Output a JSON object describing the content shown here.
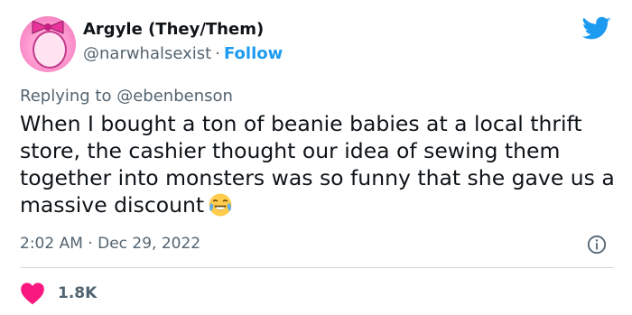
{
  "author": {
    "name": "Argyle (They/Them)",
    "handle": "@narwhalsexist",
    "separator": "·",
    "follow_label": "Follow"
  },
  "reply": {
    "prefix": "Replying to",
    "mention": "@ebenbenson"
  },
  "tweet": {
    "text": "When I bought a ton of beanie babies at a local thrift store, the cashier thought our idea of sewing them together into monsters was so funny that she gave us a massive discount",
    "emoji": "face-with-tears-of-joy"
  },
  "meta": {
    "time": "2:02 AM",
    "separator": "·",
    "date": "Dec 29, 2022"
  },
  "likes": {
    "count": "1.8K"
  },
  "colors": {
    "accent": "#1d9bf0",
    "heart": "#f91880",
    "secondary_text": "#536471"
  },
  "icons": {
    "brand": "twitter-bird-icon",
    "info": "info-icon",
    "like": "heart-icon"
  }
}
